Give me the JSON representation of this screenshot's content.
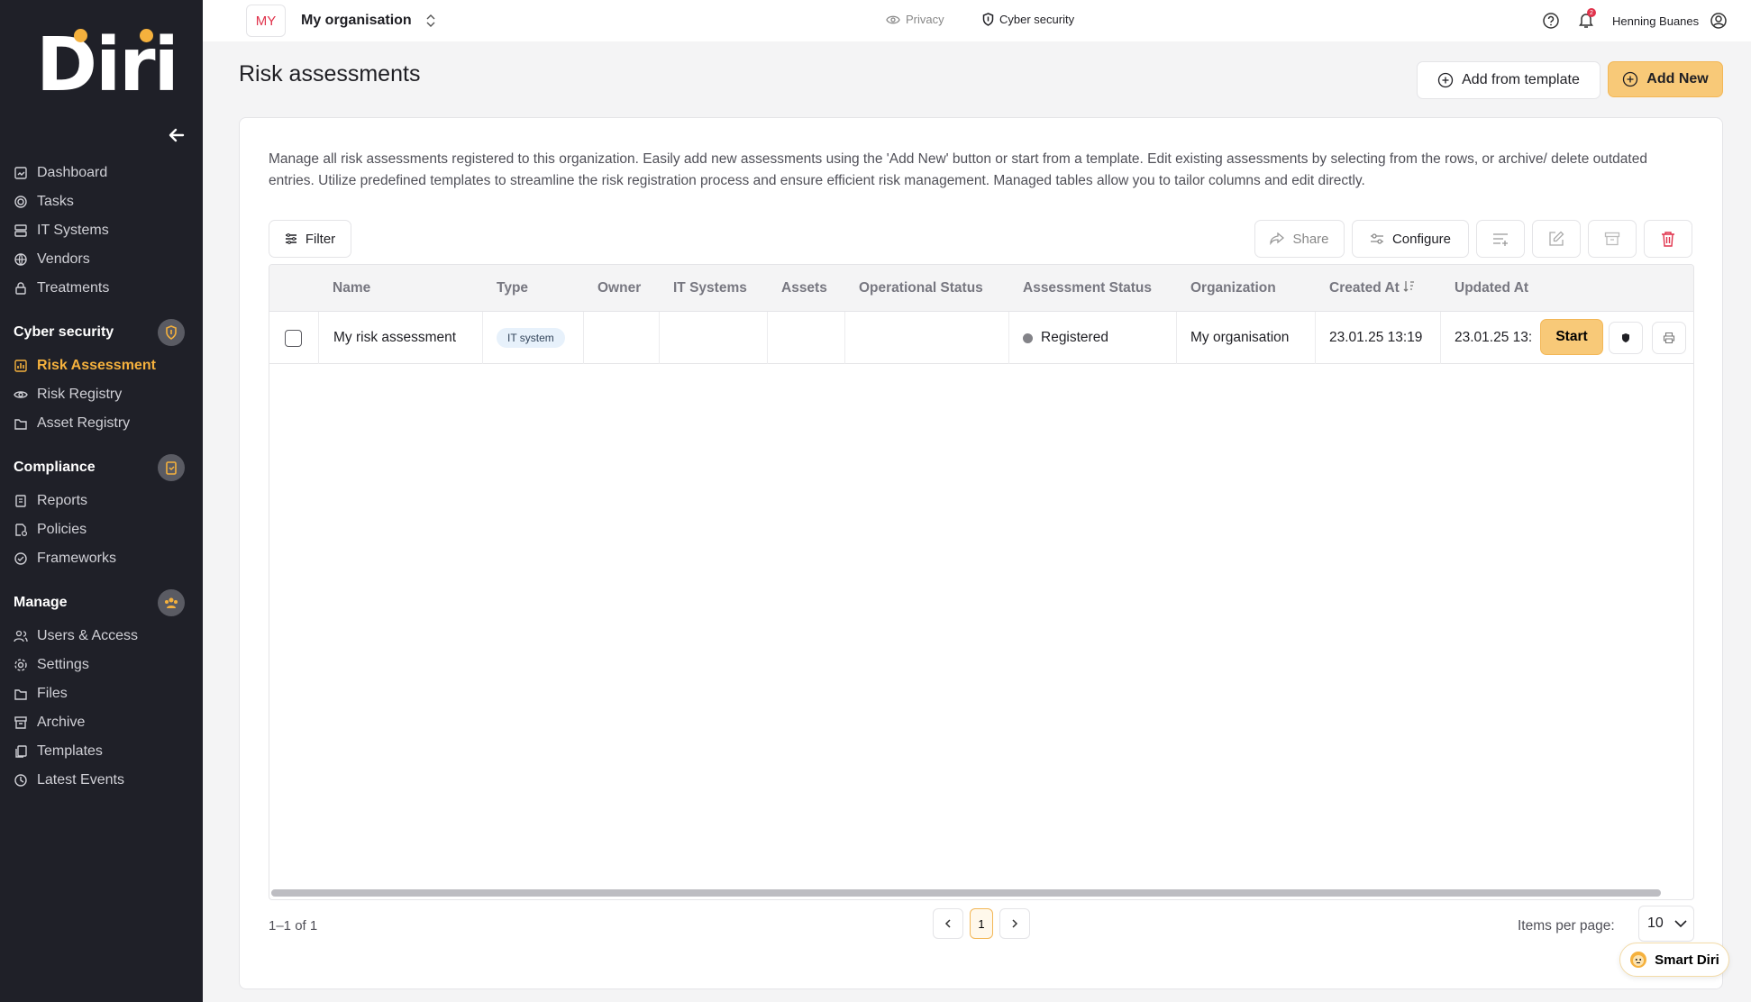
{
  "app": {
    "logo_text": "Diri"
  },
  "topbar": {
    "org_badge": "MY",
    "org_name": "My organisation",
    "privacy_label": "Privacy",
    "cyber_label": "Cyber security",
    "notification_count": "2",
    "user_name": "Henning Buanes"
  },
  "sidebar": {
    "items_top": [
      {
        "label": "Dashboard",
        "icon": "dashboard-icon"
      },
      {
        "label": "Tasks",
        "icon": "target-icon"
      },
      {
        "label": "IT Systems",
        "icon": "server-icon"
      },
      {
        "label": "Vendors",
        "icon": "globe-icon"
      },
      {
        "label": "Treatments",
        "icon": "lock-icon"
      }
    ],
    "section_cyber": "Cyber security",
    "items_cyber": [
      {
        "label": "Risk Assessment",
        "icon": "chart-icon",
        "active": true
      },
      {
        "label": "Risk Registry",
        "icon": "eye-icon"
      },
      {
        "label": "Asset Registry",
        "icon": "folder-icon"
      }
    ],
    "section_compliance": "Compliance",
    "items_compliance": [
      {
        "label": "Reports",
        "icon": "clipboard-icon"
      },
      {
        "label": "Policies",
        "icon": "gear-doc-icon"
      },
      {
        "label": "Frameworks",
        "icon": "check-circle-icon"
      }
    ],
    "section_manage": "Manage",
    "items_manage": [
      {
        "label": "Users & Access",
        "icon": "users-icon"
      },
      {
        "label": "Settings",
        "icon": "gear-icon"
      },
      {
        "label": "Files",
        "icon": "files-icon"
      },
      {
        "label": "Archive",
        "icon": "archive-icon"
      },
      {
        "label": "Templates",
        "icon": "templates-icon"
      },
      {
        "label": "Latest Events",
        "icon": "clock-icon"
      }
    ]
  },
  "page": {
    "title": "Risk assessments",
    "add_from_template": "Add from template",
    "add_new": "Add New",
    "description": "Manage all risk assessments registered to this organization. Easily add new assessments using the 'Add New' button or start from a template. Edit existing assessments by selecting from the rows, or archive/ delete outdated entries. Utilize predefined templates to streamline the risk registration process and ensure efficient risk management. Managed tables allow you to tailor columns and edit directly."
  },
  "toolbar": {
    "filter": "Filter",
    "share": "Share",
    "configure": "Configure"
  },
  "table": {
    "columns": [
      "Name",
      "Type",
      "Owner",
      "IT Systems",
      "Assets",
      "Operational Status",
      "Assessment Status",
      "Organization",
      "Created At",
      "Updated At"
    ],
    "rows": [
      {
        "name": "My risk assessment",
        "type": "IT system",
        "owner": "",
        "it_systems": "",
        "assets": "",
        "operational_status": "",
        "assessment_status": "Registered",
        "organization": "My organisation",
        "created_at": "23.01.25 13:19",
        "updated_at": "23.01.25 13:",
        "action": "Start"
      }
    ]
  },
  "pagination": {
    "range": "1–1 of 1",
    "current_page": "1",
    "items_per_page_label": "Items per page:",
    "items_per_page": "10"
  },
  "assistant": {
    "label": "Smart Diri"
  },
  "colors": {
    "accent": "#f8c978",
    "sidebar_bg": "#1f2028",
    "active_nav": "#f5b13d",
    "danger": "#e0324b"
  }
}
